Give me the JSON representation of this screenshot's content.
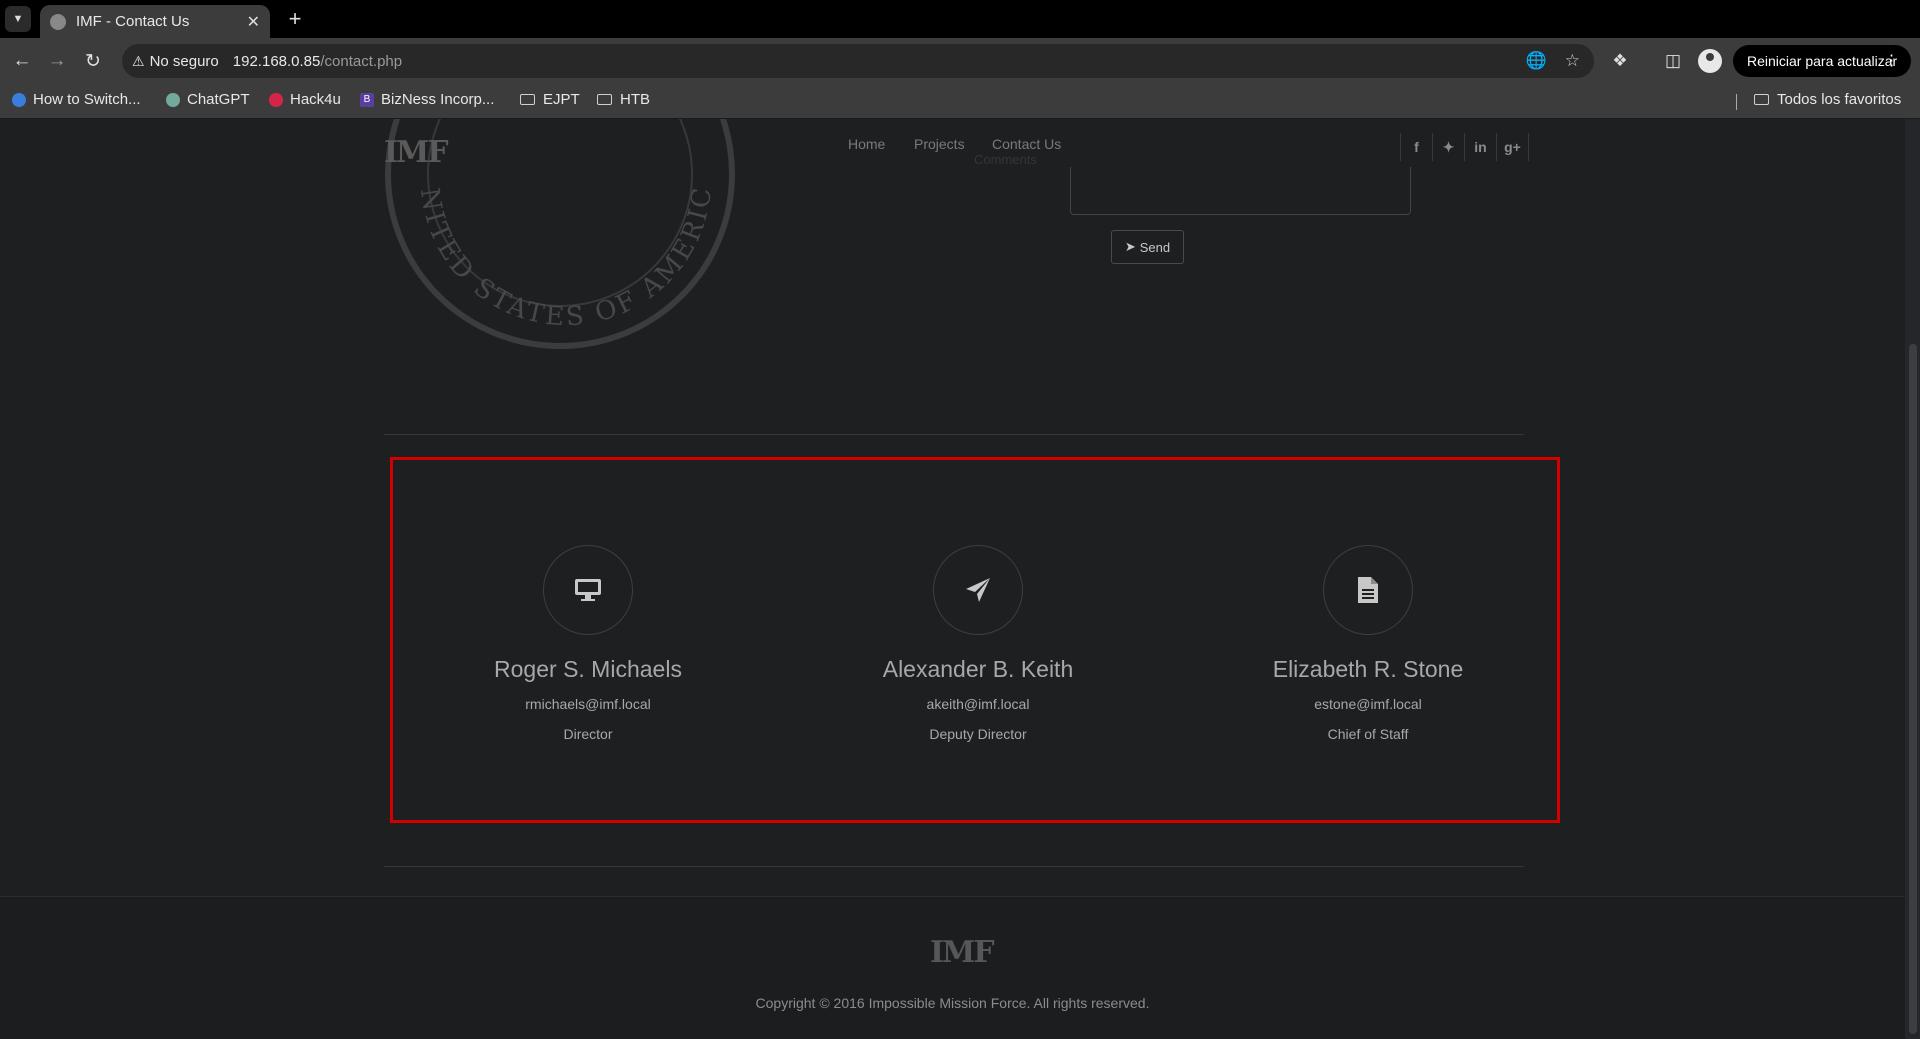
{
  "browser": {
    "tab_title": "IMF - Contact Us",
    "security_label": "No seguro",
    "url_host": "192.168.0.85",
    "url_path": "/contact.php",
    "update_button": "Reiniciar para actualizar",
    "bookmarks": [
      "How to Switch...",
      "ChatGPT",
      "Hack4u",
      "BizNess Incorp...",
      "EJPT",
      "HTB"
    ],
    "all_bookmarks": "Todos los favoritos"
  },
  "site": {
    "logo": "IMF",
    "nav": [
      "Home",
      "Projects",
      "Contact Us"
    ],
    "ghost_label": "Comments",
    "send_label": "Send",
    "seal_text": "UNITED STATES OF AMERICA"
  },
  "contacts": [
    {
      "icon": "monitor-icon",
      "name": "Roger S. Michaels",
      "email": "rmichaels@imf.local",
      "role": "Director"
    },
    {
      "icon": "paper-plane-icon",
      "name": "Alexander B. Keith",
      "email": "akeith@imf.local",
      "role": "Deputy Director"
    },
    {
      "icon": "document-icon",
      "name": "Elizabeth R. Stone",
      "email": "estone@imf.local",
      "role": "Chief of Staff"
    }
  ],
  "footer": {
    "logo": "IMF",
    "copyright": "Copyright © 2016 Impossible Mission Force. All rights reserved."
  },
  "colors": {
    "highlight_border": "#d40000",
    "page_background": "#1d1f21"
  }
}
